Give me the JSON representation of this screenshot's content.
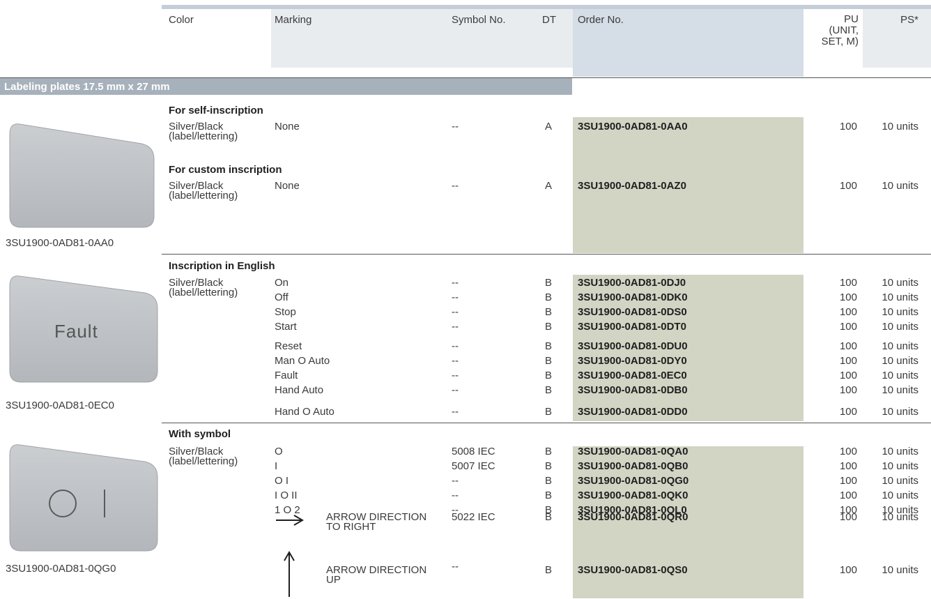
{
  "headers": {
    "color": "Color",
    "marking": "Marking",
    "symbol_no": "Symbol No.",
    "dt": "DT",
    "order_no": "Order No.",
    "pu_line1": "PU",
    "pu_line2": "(UNIT,",
    "pu_line3": "SET, M)",
    "ps": "PS*"
  },
  "section_title": "Labeling plates 17.5 mm x 27 mm",
  "groups": {
    "self": {
      "heading": "For self-inscription",
      "color1": "Silver/Black",
      "color2": "(label/lettering)",
      "marking": "None",
      "symbol": "--",
      "dt": "A",
      "order": "3SU1900-0AD81-0AA0",
      "pu": "100",
      "ps": "10 units"
    },
    "custom": {
      "heading": "For custom inscription",
      "color1": "Silver/Black",
      "color2": "(label/lettering)",
      "marking": "None",
      "symbol": "--",
      "dt": "A",
      "order": "3SU1900-0AD81-0AZ0",
      "pu": "100",
      "ps": "10 units"
    },
    "english": {
      "heading": "Inscription in English",
      "color1": "Silver/Black",
      "color2": "(label/lettering)",
      "rows": [
        {
          "marking": "On",
          "symbol": "--",
          "dt": "B",
          "order": "3SU1900-0AD81-0DJ0",
          "pu": "100",
          "ps": "10 units"
        },
        {
          "marking": "Off",
          "symbol": "--",
          "dt": "B",
          "order": "3SU1900-0AD81-0DK0",
          "pu": "100",
          "ps": "10 units"
        },
        {
          "marking": "Stop",
          "symbol": "--",
          "dt": "B",
          "order": "3SU1900-0AD81-0DS0",
          "pu": "100",
          "ps": "10 units"
        },
        {
          "marking": "Start",
          "symbol": "--",
          "dt": "B",
          "order": "3SU1900-0AD81-0DT0",
          "pu": "100",
          "ps": "10 units"
        },
        {
          "marking": "Reset",
          "symbol": "--",
          "dt": "B",
          "order": "3SU1900-0AD81-0DU0",
          "pu": "100",
          "ps": "10 units"
        },
        {
          "marking": "Man O Auto",
          "symbol": "--",
          "dt": "B",
          "order": "3SU1900-0AD81-0DY0",
          "pu": "100",
          "ps": "10 units"
        },
        {
          "marking": "Fault",
          "symbol": "--",
          "dt": "B",
          "order": "3SU1900-0AD81-0EC0",
          "pu": "100",
          "ps": "10 units"
        },
        {
          "marking": "Hand Auto",
          "symbol": "--",
          "dt": "B",
          "order": "3SU1900-0AD81-0DB0",
          "pu": "100",
          "ps": "10 units"
        },
        {
          "marking": "Hand O Auto",
          "symbol": "--",
          "dt": "B",
          "order": "3SU1900-0AD81-0DD0",
          "pu": "100",
          "ps": "10 units"
        }
      ]
    },
    "symbol": {
      "heading": "With symbol",
      "color1": "Silver/Black",
      "color2": "(label/lettering)",
      "rows": [
        {
          "marking": "O",
          "symbol": "5008 IEC",
          "dt": "B",
          "order": "3SU1900-0AD81-0QA0",
          "pu": "100",
          "ps": "10 units"
        },
        {
          "marking": "I",
          "symbol": "5007 IEC",
          "dt": "B",
          "order": "3SU1900-0AD81-0QB0",
          "pu": "100",
          "ps": "10 units"
        },
        {
          "marking": "O I",
          "symbol": "--",
          "dt": "B",
          "order": "3SU1900-0AD81-0QG0",
          "pu": "100",
          "ps": "10 units"
        },
        {
          "marking": "I O II",
          "symbol": "--",
          "dt": "B",
          "order": "3SU1900-0AD81-0QK0",
          "pu": "100",
          "ps": "10 units"
        },
        {
          "marking": "1 O 2",
          "symbol": "--",
          "dt": "B",
          "order": "3SU1900-0AD81-0QL0",
          "pu": "100",
          "ps": "10 units"
        }
      ],
      "arrow_right": {
        "desc1": "ARROW DIRECTION",
        "desc2": "TO RIGHT",
        "symbol": "5022 IEC",
        "dt": "B",
        "order": "3SU1900-0AD81-0QR0",
        "pu": "100",
        "ps": "10 units"
      },
      "arrow_up": {
        "desc1": "ARROW DIRECTION",
        "desc2": "UP",
        "symbol": "--",
        "dt": "B",
        "order": "3SU1900-0AD81-0QS0",
        "pu": "100",
        "ps": "10 units"
      }
    }
  },
  "images": {
    "plate1": {
      "caption": "3SU1900-0AD81-0AA0",
      "text": ""
    },
    "plate2": {
      "caption": "3SU1900-0AD81-0EC0",
      "text": "Fault"
    },
    "plate3": {
      "caption": "3SU1900-0AD81-0QG0",
      "text": "O I"
    }
  },
  "colors": {
    "header_bg": "#e9ecef",
    "order_header_bg": "#d5dde6",
    "section_bar": "#a7b1bb",
    "order_cell_bg": "#d2d4c4"
  }
}
